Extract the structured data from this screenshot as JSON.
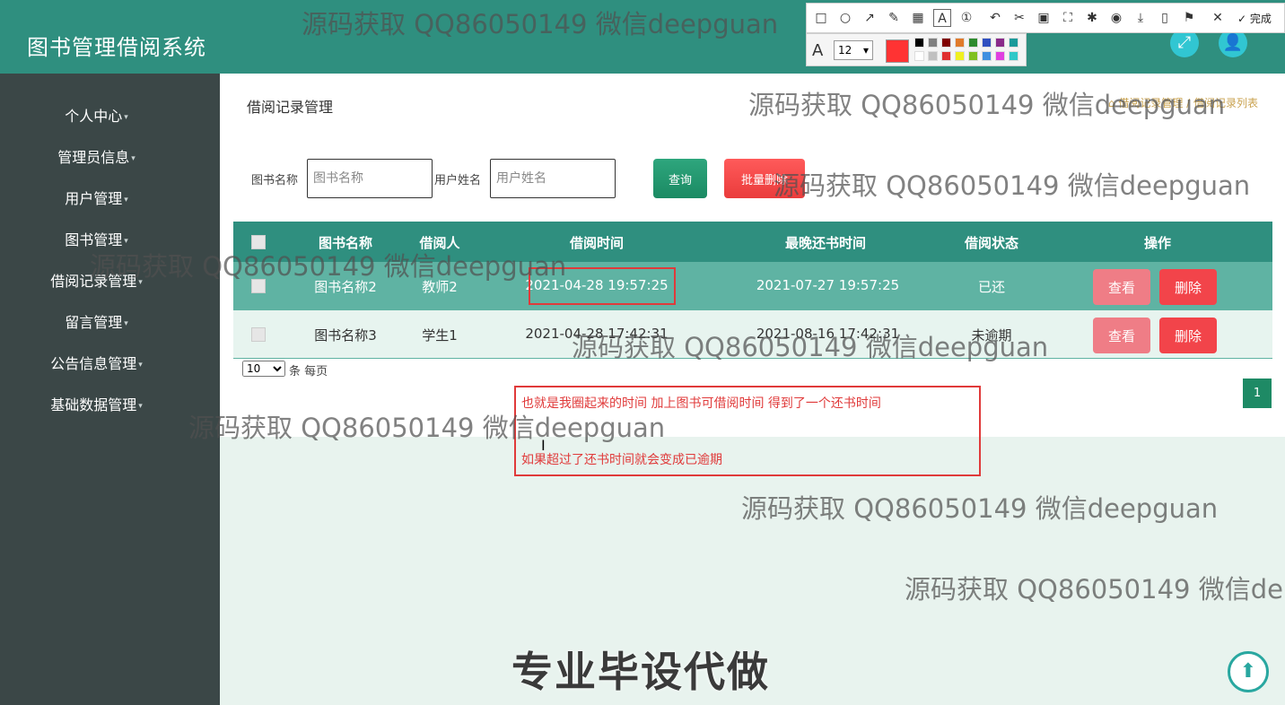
{
  "app_title": "图书管理借阅系统",
  "sidebar": {
    "items": [
      {
        "label": "个人中心"
      },
      {
        "label": "管理员信息"
      },
      {
        "label": "用户管理"
      },
      {
        "label": "图书管理"
      },
      {
        "label": "借阅记录管理"
      },
      {
        "label": "留言管理"
      },
      {
        "label": "公告信息管理"
      },
      {
        "label": "基础数据管理"
      }
    ],
    "caret_icon": "▾"
  },
  "header": {
    "fullscreen_icon": "fullscreen-icon",
    "user_icon": "user-icon"
  },
  "page": {
    "title": "借阅记录管理",
    "breadcrumb": "借阅记录管理 / 借阅记录列表"
  },
  "search": {
    "book_name_label": "图书名称",
    "book_name_placeholder": "图书名称",
    "user_name_label": "用户姓名",
    "user_name_placeholder": "用户姓名",
    "query_label": "查询",
    "batch_delete_label": "批量删除"
  },
  "table": {
    "columns": [
      "图书名称",
      "借阅人",
      "借阅时间",
      "最晚还书时间",
      "借阅状态",
      "操作"
    ],
    "rows": [
      {
        "book": "图书名称2",
        "borrower": "教师2",
        "borrow_time": "2021-04-28 19:57:25",
        "due_time": "2021-07-27 19:57:25",
        "status": "已还",
        "view": "查看",
        "delete": "删除"
      },
      {
        "book": "图书名称3",
        "borrower": "学生1",
        "borrow_time": "2021-04-28 17:42:31",
        "due_time": "2021-08-16 17:42:31",
        "status": "未逾期",
        "view": "查看",
        "delete": "删除"
      }
    ]
  },
  "pagination": {
    "page_size": "10",
    "per_page_label": "条 每页",
    "current_page": "1"
  },
  "annotation": {
    "line1": "也就是我圈起来的时间 加上图书可借阅时间 得到了一个还书时间",
    "line2": "如果超过了还书时间就会变成已逾期"
  },
  "watermark": {
    "text": "源码获取 QQ86050149 微信deepguan",
    "text_cut": "源码获取 QQ86050149 微信de",
    "big": "专业毕设代做"
  },
  "screenshot_tool": {
    "done_label": "完成",
    "font_size": "12",
    "font_glyph": "A",
    "current_color": "#ff3333",
    "swatches": [
      "#000000",
      "#808080",
      "#800000",
      "#e07a2a",
      "#2e8b2e",
      "#3050c0",
      "#8a2a8a",
      "#1a9a9a",
      "#ffffff",
      "#c0c0c0",
      "#e03030",
      "#f0f020",
      "#80c020",
      "#4090e0",
      "#e040e0",
      "#30c8c8"
    ],
    "tool_icons": [
      "rect-icon",
      "circle-icon",
      "arrow-icon",
      "pen-icon",
      "mosaic-icon",
      "text-icon",
      "number-icon",
      "undo-icon",
      "cut-icon",
      "ocr-icon",
      "crop-icon",
      "pin-icon",
      "record-icon",
      "download-icon",
      "phone-icon",
      "bookmark-icon",
      "close-icon",
      "check-icon"
    ]
  },
  "colors": {
    "topbar": "#2f8f7f",
    "sidebar": "#3b4747",
    "accent": "#2f8f7f",
    "danger": "#f2444a"
  }
}
